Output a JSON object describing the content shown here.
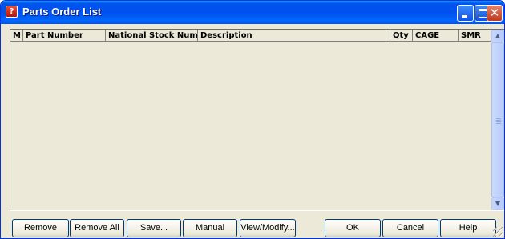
{
  "window": {
    "title": "Parts Order List",
    "icon": "app-red-icon",
    "icon_glyph": "?"
  },
  "title_buttons": {
    "minimize": "minimize-icon",
    "maximize": "maximize-icon",
    "close": "close-icon",
    "close_glyph": "✕"
  },
  "table": {
    "columns": [
      "M",
      "Part Number",
      "National Stock Number",
      "Description",
      "Qty",
      "CAGE",
      "SMR"
    ],
    "rows": []
  },
  "scrollbar": {
    "up_glyph": "▲",
    "down_glyph": "▼"
  },
  "buttons": {
    "remove": "Remove",
    "remove_all": "Remove All",
    "save": "Save...",
    "manual_add": "Manual Add...",
    "view_modify": "View/Modify...",
    "ok": "OK",
    "cancel": "Cancel",
    "help": "Help"
  },
  "colors": {
    "titlebar": "#0053ee",
    "window_bg": "#ece9d8",
    "close_button": "#c0391c"
  }
}
